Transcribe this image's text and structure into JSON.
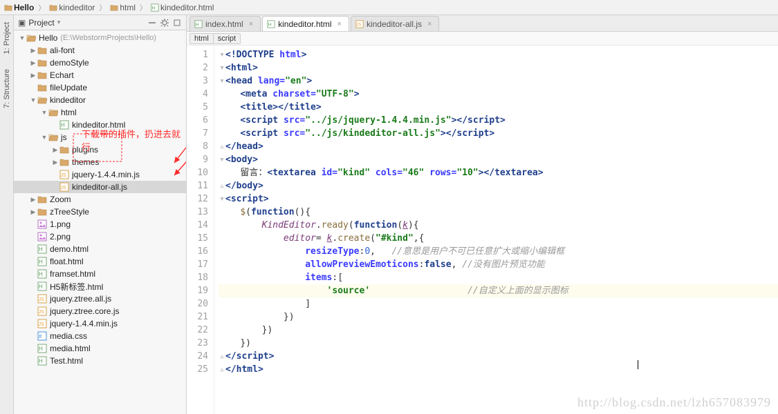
{
  "breadcrumb": [
    {
      "label": "Hello",
      "bold": true,
      "icon": "folder"
    },
    {
      "label": "kindeditor",
      "icon": "folder"
    },
    {
      "label": "html",
      "icon": "folder"
    },
    {
      "label": "kindeditor.html",
      "icon": "html"
    }
  ],
  "tool_tabs": {
    "project": "1: Project",
    "structure": "7: Structure"
  },
  "project_header": {
    "title": "Project"
  },
  "tree": {
    "root": {
      "name": "Hello",
      "hint": "(E:\\WebstormProjects\\Hello)"
    },
    "nodes": [
      {
        "d": 1,
        "t": "folder-c",
        "arrow": "right",
        "name": "ali-font"
      },
      {
        "d": 1,
        "t": "folder-c",
        "arrow": "right",
        "name": "demoStyle"
      },
      {
        "d": 1,
        "t": "folder-c",
        "arrow": "right",
        "name": "Echart"
      },
      {
        "d": 1,
        "t": "folder-c",
        "arrow": "none",
        "name": "fileUpdate"
      },
      {
        "d": 1,
        "t": "folder-o",
        "arrow": "down",
        "name": "kindeditor"
      },
      {
        "d": 2,
        "t": "folder-o",
        "arrow": "down",
        "name": "html"
      },
      {
        "d": 3,
        "t": "html",
        "arrow": "none",
        "name": "kindeditor.html"
      },
      {
        "d": 2,
        "t": "folder-o",
        "arrow": "down",
        "name": "js"
      },
      {
        "d": 3,
        "t": "folder-c",
        "arrow": "right",
        "name": "plugins"
      },
      {
        "d": 3,
        "t": "folder-c",
        "arrow": "right",
        "name": "themes"
      },
      {
        "d": 3,
        "t": "js",
        "arrow": "none",
        "name": "jquery-1.4.4.min.js"
      },
      {
        "d": 3,
        "t": "js",
        "arrow": "none",
        "name": "kindeditor-all.js",
        "sel": true
      },
      {
        "d": 1,
        "t": "folder-c",
        "arrow": "right",
        "name": "Zoom"
      },
      {
        "d": 1,
        "t": "folder-c",
        "arrow": "right",
        "name": "zTreeStyle"
      },
      {
        "d": 1,
        "t": "img",
        "arrow": "none",
        "name": "1.png"
      },
      {
        "d": 1,
        "t": "img",
        "arrow": "none",
        "name": "2.png"
      },
      {
        "d": 1,
        "t": "html",
        "arrow": "none",
        "name": "demo.html"
      },
      {
        "d": 1,
        "t": "html",
        "arrow": "none",
        "name": "float.html"
      },
      {
        "d": 1,
        "t": "html",
        "arrow": "none",
        "name": "framset.html"
      },
      {
        "d": 1,
        "t": "html",
        "arrow": "none",
        "name": "H5新标签.html"
      },
      {
        "d": 1,
        "t": "js",
        "arrow": "none",
        "name": "jquery.ztree.all.js"
      },
      {
        "d": 1,
        "t": "js",
        "arrow": "none",
        "name": "jquery.ztree.core.js"
      },
      {
        "d": 1,
        "t": "js",
        "arrow": "none",
        "name": "jquery-1.4.4.min.js"
      },
      {
        "d": 1,
        "t": "css",
        "arrow": "none",
        "name": "media.css"
      },
      {
        "d": 1,
        "t": "html",
        "arrow": "none",
        "name": "media.html"
      },
      {
        "d": 1,
        "t": "html",
        "arrow": "none",
        "name": "Test.html"
      }
    ]
  },
  "annotation_text": "下载带的插件，扔进去就行",
  "editor_tabs": [
    {
      "label": "index.html",
      "icon": "html",
      "active": false
    },
    {
      "label": "kindeditor.html",
      "icon": "html",
      "active": true
    },
    {
      "label": "kindeditor-all.js",
      "icon": "js",
      "active": false
    }
  ],
  "sub_breadcrumb": [
    "html",
    "script"
  ],
  "code_lines": [
    {
      "n": 1,
      "html": "<span class='fold'>&#9662;</span><span class='tag'>&lt;!DOCTYPE</span> <span class='attr'>html</span><span class='tag'>&gt;</span>"
    },
    {
      "n": 2,
      "html": "<span class='fold'>&#9662;</span><span class='tag'>&lt;html&gt;</span>"
    },
    {
      "n": 3,
      "html": "<span class='fold'>&#9662;</span><span class='tag'>&lt;head</span> <span class='attr'>lang=</span><span class='str'>\"en\"</span><span class='tag'>&gt;</span>"
    },
    {
      "n": 4,
      "html": "    <span class='tag'>&lt;meta</span> <span class='attr'>charset=</span><span class='str'>\"UTF-8\"</span><span class='tag'>&gt;</span>"
    },
    {
      "n": 5,
      "html": "    <span class='tag'>&lt;title&gt;&lt;/title&gt;</span>"
    },
    {
      "n": 6,
      "html": "    <span class='tag'>&lt;script</span> <span class='attr'>src=</span><span class='str'>\"../js/jquery-1.4.4.min.js\"</span><span class='tag'>&gt;&lt;/script&gt;</span>"
    },
    {
      "n": 7,
      "html": "    <span class='tag'>&lt;script</span> <span class='attr'>src=</span><span class='str'>\"../js/kindeditor-all.js\"</span><span class='tag'>&gt;&lt;/script&gt;</span>"
    },
    {
      "n": 8,
      "html": "<span class='fold'>&#9653;</span><span class='tag'>&lt;/head&gt;</span>"
    },
    {
      "n": 9,
      "html": "<span class='fold'>&#9662;</span><span class='tag'>&lt;body&gt;</span>"
    },
    {
      "n": 10,
      "html": "    <span class='txt'>留言：</span><span class='tag'>&lt;textarea</span> <span class='attr'>id=</span><span class='str'>\"kind\"</span> <span class='attr'>cols=</span><span class='str'>\"46\"</span> <span class='attr'>rows=</span><span class='str'>\"10\"</span><span class='tag'>&gt;&lt;/textarea&gt;</span>"
    },
    {
      "n": 11,
      "html": "<span class='fold'>&#9653;</span><span class='tag'>&lt;/body&gt;</span>"
    },
    {
      "n": 12,
      "html": "<span class='fold'>&#9662;</span><span class='tag'>&lt;script&gt;</span>"
    },
    {
      "n": 13,
      "html": "    <span class='fn'>$</span><span class='punct'>(</span><span class='kw'>function</span><span class='punct'>(){</span>"
    },
    {
      "n": 14,
      "html": "        <span class='var'>KindEditor</span><span class='punct'>.</span><span class='fn'>ready</span><span class='punct'>(</span><span class='kw'>function</span><span class='punct'>(</span><span class='varu'>k</span><span class='punct'>){</span>"
    },
    {
      "n": 15,
      "html": "            <span class='var'>editor</span><span class='punct'>=</span> <span class='varu'>k</span><span class='punct'>.</span><span class='fn'>create</span><span class='punct'>(</span><span class='str'>\"#kind\"</span><span class='punct'>,{</span>"
    },
    {
      "n": 16,
      "html": "                <span class='attr'>resizeType</span><span class='punct'>:</span><span class='num'>0</span><span class='punct'>,</span>   <span class='com'>//意思是用户不可已任意扩大或缩小编辑框</span>"
    },
    {
      "n": 17,
      "html": "                <span class='attr'>allowPreviewEmoticons</span><span class='punct'>:</span><span class='kw'>false</span><span class='punct'>,</span> <span class='com'>//没有图片预览功能</span>"
    },
    {
      "n": 18,
      "html": "                <span class='attr'>items</span><span class='punct'>:[</span>"
    },
    {
      "n": 19,
      "hl": true,
      "html": "                    <span class='str'>'source'</span>                  <span class='com'>//自定义上面的显示图标</span>"
    },
    {
      "n": 20,
      "html": "                <span class='punct'>]</span>"
    },
    {
      "n": 21,
      "html": "            <span class='punct'>})</span>"
    },
    {
      "n": 22,
      "html": "        <span class='punct'>})</span>"
    },
    {
      "n": 23,
      "html": "    <span class='punct'>})</span>"
    },
    {
      "n": 24,
      "html": "<span class='fold'>&#9653;</span><span class='tag'>&lt;/script&gt;</span>"
    },
    {
      "n": 25,
      "html": "<span class='fold'>&#9653;</span><span class='tag'>&lt;/html&gt;</span>"
    }
  ],
  "watermark": "http://blog.csdn.net/lzh657083979"
}
